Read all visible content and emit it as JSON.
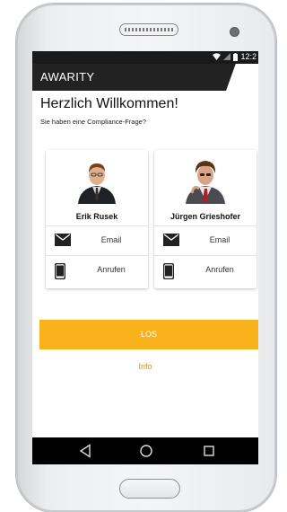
{
  "status_bar": {
    "time": "12:2"
  },
  "app_bar": {
    "title": "AWARITY"
  },
  "main": {
    "welcome": "Herzlich Willkommen!",
    "question": "Sie haben eine Compliance-Frage?",
    "contacts": [
      {
        "name": "Erik Rusek",
        "email_label": "Email",
        "call_label": "Anrufen"
      },
      {
        "name": "Jürgen Grieshofer",
        "email_label": "Email",
        "call_label": "Anrufen"
      }
    ],
    "los_button": "LOS",
    "info_link": "Info"
  },
  "icons": {
    "email": "envelope-icon",
    "call": "phone-icon",
    "nav_back": "back-triangle-icon",
    "nav_home": "home-circle-icon",
    "nav_recent": "recent-square-icon"
  },
  "colors": {
    "accent": "#f9b21c",
    "info": "#d48a1a",
    "appbar": "#222222"
  }
}
